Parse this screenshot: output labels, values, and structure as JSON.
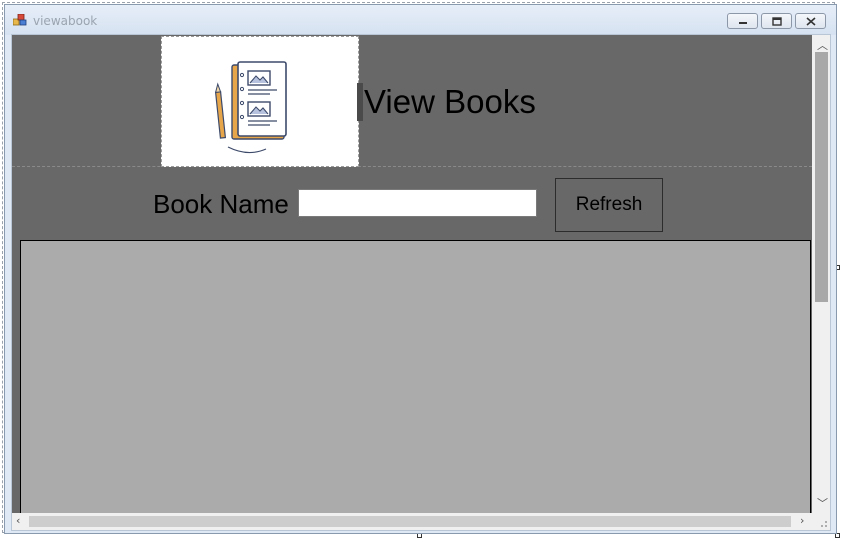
{
  "window": {
    "title": "viewabook",
    "controls": [
      "minimize",
      "restore",
      "close"
    ]
  },
  "header": {
    "title": "View Books",
    "logo_icon": "book-with-pencil-icon"
  },
  "search": {
    "label": "Book Name",
    "value": "",
    "placeholder": ""
  },
  "toolbar": {
    "refresh_label": "Refresh"
  },
  "colors": {
    "form_background": "#686868",
    "grid_background": "#ababab",
    "titlebar": "#dfe9f5"
  }
}
